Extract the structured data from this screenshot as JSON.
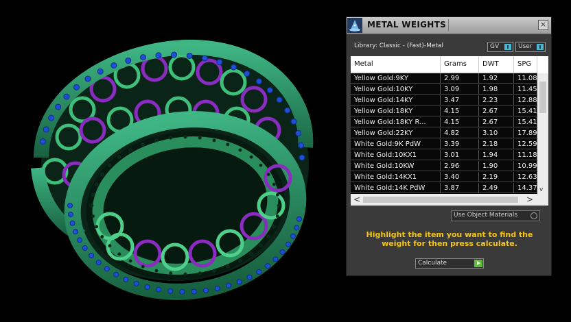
{
  "window": {
    "title": "METAL WEIGHTS",
    "close_glyph": "×",
    "icon": "wizard-hat-icon"
  },
  "library": {
    "label": "Library: Classic - (Fast)-Metal"
  },
  "toggles": [
    {
      "label": "GV",
      "state": "on"
    },
    {
      "label": "User",
      "state": "on"
    }
  ],
  "table": {
    "headers": [
      "Metal",
      "Grams",
      "DWT",
      "SPG"
    ],
    "rows": [
      [
        "Yellow Gold:9KY",
        "2.99",
        "1.92",
        "11.08"
      ],
      [
        "Yellow Gold:10KY",
        "3.09",
        "1.98",
        "11.45"
      ],
      [
        "Yellow Gold:14KY",
        "3.47",
        "2.23",
        "12.88"
      ],
      [
        "Yellow Gold:18KY",
        "4.15",
        "2.67",
        "15.41"
      ],
      [
        "Yellow Gold:18KY R...",
        "4.15",
        "2.67",
        "15.41"
      ],
      [
        "Yellow Gold:22KY",
        "4.82",
        "3.10",
        "17.89"
      ],
      [
        "White Gold:9K PdW",
        "3.39",
        "2.18",
        "12.59"
      ],
      [
        "White Gold:10KX1",
        "3.01",
        "1.94",
        "11.18"
      ],
      [
        "White Gold:10KW",
        "2.96",
        "1.90",
        "10.99"
      ],
      [
        "White Gold:14KX1",
        "3.40",
        "2.19",
        "12.63"
      ],
      [
        "White Gold:14K PdW",
        "3.87",
        "2.49",
        "14.37"
      ]
    ],
    "scroll_down_glyph": "v",
    "scroll_left_glyph": "<",
    "scroll_right_glyph": ">"
  },
  "use_object_materials": {
    "label": "Use Object Materials"
  },
  "instruction": "Highlight the item you want to find the weight for then press calculate.",
  "calculate": {
    "label": "Calculate"
  },
  "colors": {
    "accent_text": "#f5c518",
    "ring_green": "#2e9e6a",
    "stone_blue": "#1f4fd6",
    "link_purple": "#8a2cc0"
  }
}
